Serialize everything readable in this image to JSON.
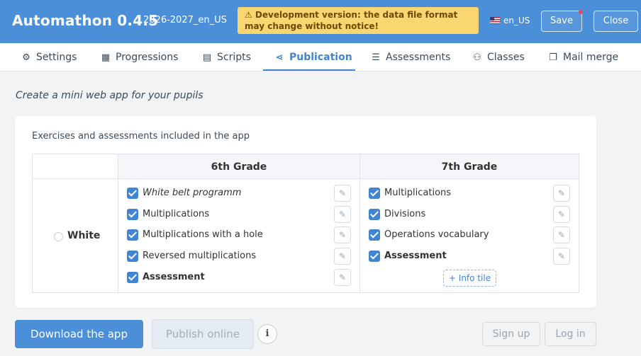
{
  "header": {
    "title": "Automathon 0.4.5",
    "year": "2026-2027_en_US",
    "dev_warning": "⚠ Development version: the data file format may change without notice!",
    "language": "en_US",
    "save_label": "Save",
    "close_label": "Close",
    "accent_color": "#4a8fd8"
  },
  "tabs": [
    {
      "label": "Settings",
      "icon": "gear-icon"
    },
    {
      "label": "Progressions",
      "icon": "calendar-icon"
    },
    {
      "label": "Scripts",
      "icon": "script-icon"
    },
    {
      "label": "Publication",
      "icon": "share-icon",
      "active": true
    },
    {
      "label": "Assessments",
      "icon": "checklist-icon"
    },
    {
      "label": "Classes",
      "icon": "users-icon"
    },
    {
      "label": "Mail merge",
      "icon": "copy-icon"
    }
  ],
  "subtitle": "Create a mini web app for your pupils",
  "panel": {
    "title": "Exercises and assessments included in the app",
    "belt": "White",
    "grades": [
      {
        "name": "6th Grade",
        "items": [
          {
            "label": "White belt programm",
            "checked": true,
            "style": "italic"
          },
          {
            "label": "Multiplications",
            "checked": true,
            "style": "normal"
          },
          {
            "label": "Multiplications with a hole",
            "checked": true,
            "style": "normal"
          },
          {
            "label": "Reversed multiplications",
            "checked": true,
            "style": "normal"
          },
          {
            "label": "Assessment",
            "checked": true,
            "style": "bold"
          }
        ]
      },
      {
        "name": "7th Grade",
        "items": [
          {
            "label": "Multiplications",
            "checked": true,
            "style": "normal"
          },
          {
            "label": "Divisions",
            "checked": true,
            "style": "normal"
          },
          {
            "label": "Operations vocabulary",
            "checked": true,
            "style": "normal"
          },
          {
            "label": "Assessment",
            "checked": true,
            "style": "bold"
          }
        ],
        "info_tile_label": "+ Info tile"
      }
    ]
  },
  "actions": {
    "download_label": "Download the app",
    "publish_label": "Publish online",
    "info_label": "i",
    "signup_label": "Sign up",
    "login_label": "Log in"
  }
}
